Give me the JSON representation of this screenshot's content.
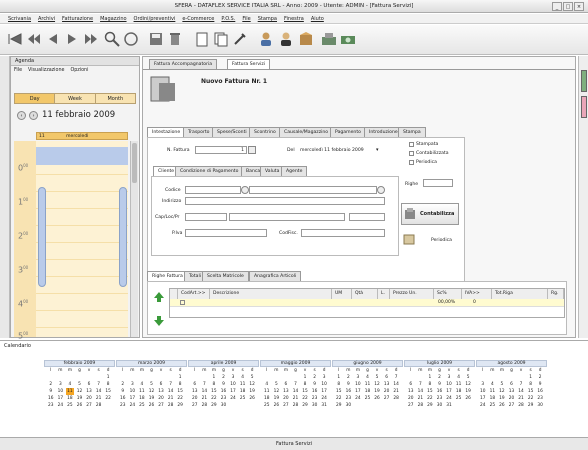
{
  "window": {
    "title": "SFERA - DATAFLEX SERVICE ITALIA SRL - Anno: 2009 - Utente: ADMIN - [Fattura Servizi]"
  },
  "menu": [
    "Scrivania",
    "Archivi",
    "Fatturazione",
    "Magazzino",
    "Ordini/preventivi",
    "e-Commerce",
    "P.O.S.",
    "File",
    "Stampa",
    "Finestra",
    "Aiuto"
  ],
  "agenda": {
    "title": "Agenda",
    "menu": [
      "File",
      "Visualizzazione",
      "Opzioni"
    ],
    "views": [
      "Day",
      "Week",
      "Month"
    ],
    "date": "11 febbraio 2009",
    "day_num": "11",
    "day_name": "mercoledì",
    "hours": [
      "0",
      "1",
      "2",
      "3",
      "4",
      "5"
    ],
    "hour_sup": "00"
  },
  "main": {
    "tabs": [
      "Fattura Accompagnatoria",
      "Fattura Servizi"
    ],
    "doc_title": "Nuovo Fattura Nr. 1",
    "sections": [
      "Intestazione",
      "Trasporto",
      "Spese/Sconti",
      "Scontrino",
      "Causale/Magazzino",
      "Pagamento",
      "Introduzione",
      "Stampa"
    ],
    "n_fattura_label": "N. Fattura",
    "n_fattura_value": "1",
    "del_label": "Del",
    "del_value": "mercoledì 11 febbraio 2009",
    "checks": [
      "Stampata",
      "Contabilizzata",
      "Periodica"
    ],
    "righe_label": "Righe",
    "cliente_tabs": [
      "Cliente",
      "Condizione di Pagamento",
      "Banca",
      "Valuta",
      "Agente"
    ],
    "fields": {
      "codice": "Codice",
      "indirizzo": "Indirizzo",
      "cap": "Cap/Loc/Pr",
      "piva": "P.Iva",
      "codfisc": "CodFisc."
    },
    "contabilizza": "Contabilizza",
    "periodica": "Periodica",
    "grid_tabs": [
      "Righe Fattura",
      "Totali",
      "Scelta Matricole",
      "Anagrafica Articoli"
    ],
    "grid_cols": [
      "CodArt.>>",
      "Descrizione",
      "UM",
      "Qtà",
      "L.",
      "Prezzo Un.",
      "Sc%",
      "IVA>>",
      "Tot.Riga",
      "Rg."
    ],
    "grid_row": {
      "sc": "00,00%",
      "iva": "0"
    }
  },
  "calendar": {
    "title": "Calendario",
    "weekday_header": [
      "l",
      "m",
      "m",
      "g",
      "v",
      "s",
      "d"
    ],
    "months": [
      {
        "name": "febbraio 2009",
        "weeks": [
          [
            "",
            "",
            "",
            "",
            "",
            "",
            "1"
          ],
          [
            "2",
            "3",
            "4",
            "5",
            "6",
            "7",
            "8"
          ],
          [
            "9",
            "10",
            "11",
            "12",
            "13",
            "14",
            "15"
          ],
          [
            "16",
            "17",
            "18",
            "19",
            "20",
            "21",
            "22"
          ],
          [
            "23",
            "24",
            "25",
            "26",
            "27",
            "28",
            ""
          ]
        ]
      },
      {
        "name": "marzo 2009",
        "weeks": [
          [
            "",
            "",
            "",
            "",
            "",
            "",
            "1"
          ],
          [
            "2",
            "3",
            "4",
            "5",
            "6",
            "7",
            "8"
          ],
          [
            "9",
            "10",
            "11",
            "12",
            "13",
            "14",
            "15"
          ],
          [
            "16",
            "17",
            "18",
            "19",
            "20",
            "21",
            "22"
          ],
          [
            "23",
            "24",
            "25",
            "26",
            "27",
            "28",
            "29"
          ]
        ]
      },
      {
        "name": "aprile 2009",
        "weeks": [
          [
            "",
            "",
            "1",
            "2",
            "3",
            "4",
            "5"
          ],
          [
            "6",
            "7",
            "8",
            "9",
            "10",
            "11",
            "12"
          ],
          [
            "13",
            "14",
            "15",
            "16",
            "17",
            "18",
            "19"
          ],
          [
            "20",
            "21",
            "22",
            "23",
            "24",
            "25",
            "26"
          ],
          [
            "27",
            "28",
            "29",
            "30",
            "",
            "",
            ""
          ]
        ]
      },
      {
        "name": "maggio 2009",
        "weeks": [
          [
            "",
            "",
            "",
            "",
            "1",
            "2",
            "3"
          ],
          [
            "4",
            "5",
            "6",
            "7",
            "8",
            "9",
            "10"
          ],
          [
            "11",
            "12",
            "13",
            "14",
            "15",
            "16",
            "17"
          ],
          [
            "18",
            "19",
            "20",
            "21",
            "22",
            "23",
            "24"
          ],
          [
            "25",
            "26",
            "27",
            "28",
            "29",
            "30",
            "31"
          ]
        ]
      },
      {
        "name": "giugno 2009",
        "weeks": [
          [
            "1",
            "2",
            "3",
            "4",
            "5",
            "6",
            "7"
          ],
          [
            "8",
            "9",
            "10",
            "11",
            "12",
            "13",
            "14"
          ],
          [
            "15",
            "16",
            "17",
            "18",
            "19",
            "20",
            "21"
          ],
          [
            "22",
            "23",
            "24",
            "25",
            "26",
            "27",
            "28"
          ],
          [
            "29",
            "30",
            "",
            "",
            "",
            "",
            ""
          ]
        ]
      },
      {
        "name": "luglio 2009",
        "weeks": [
          [
            "",
            "",
            "1",
            "2",
            "3",
            "4",
            "5"
          ],
          [
            "6",
            "7",
            "8",
            "9",
            "10",
            "11",
            "12"
          ],
          [
            "13",
            "14",
            "15",
            "16",
            "17",
            "18",
            "19"
          ],
          [
            "20",
            "21",
            "22",
            "23",
            "24",
            "25",
            "26"
          ],
          [
            "27",
            "28",
            "29",
            "30",
            "31",
            "",
            ""
          ]
        ]
      },
      {
        "name": "agosto 2009",
        "weeks": [
          [
            "",
            "",
            "",
            "",
            "",
            "1",
            "2"
          ],
          [
            "3",
            "4",
            "5",
            "6",
            "7",
            "8",
            "9"
          ],
          [
            "10",
            "11",
            "12",
            "13",
            "14",
            "15",
            "16"
          ],
          [
            "17",
            "18",
            "19",
            "20",
            "21",
            "22",
            "23"
          ],
          [
            "24",
            "25",
            "26",
            "27",
            "28",
            "29",
            "30"
          ]
        ]
      }
    ]
  },
  "status": "Fattura Servizi",
  "colors": {
    "agenda_header": "#f2c76a",
    "today": "#f5a623",
    "selection": "#b9cbea",
    "accent": "#3a7a3a"
  }
}
